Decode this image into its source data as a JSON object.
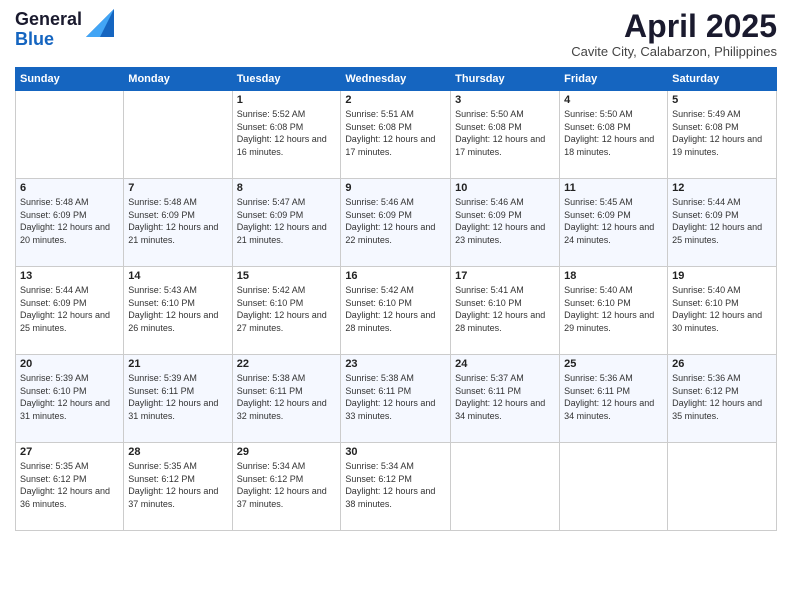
{
  "header": {
    "logo_general": "General",
    "logo_blue": "Blue",
    "month_title": "April 2025",
    "location": "Cavite City, Calabarzon, Philippines"
  },
  "days_of_week": [
    "Sunday",
    "Monday",
    "Tuesday",
    "Wednesday",
    "Thursday",
    "Friday",
    "Saturday"
  ],
  "weeks": [
    [
      {
        "num": "",
        "info": ""
      },
      {
        "num": "",
        "info": ""
      },
      {
        "num": "1",
        "info": "Sunrise: 5:52 AM\nSunset: 6:08 PM\nDaylight: 12 hours and 16 minutes."
      },
      {
        "num": "2",
        "info": "Sunrise: 5:51 AM\nSunset: 6:08 PM\nDaylight: 12 hours and 17 minutes."
      },
      {
        "num": "3",
        "info": "Sunrise: 5:50 AM\nSunset: 6:08 PM\nDaylight: 12 hours and 17 minutes."
      },
      {
        "num": "4",
        "info": "Sunrise: 5:50 AM\nSunset: 6:08 PM\nDaylight: 12 hours and 18 minutes."
      },
      {
        "num": "5",
        "info": "Sunrise: 5:49 AM\nSunset: 6:08 PM\nDaylight: 12 hours and 19 minutes."
      }
    ],
    [
      {
        "num": "6",
        "info": "Sunrise: 5:48 AM\nSunset: 6:09 PM\nDaylight: 12 hours and 20 minutes."
      },
      {
        "num": "7",
        "info": "Sunrise: 5:48 AM\nSunset: 6:09 PM\nDaylight: 12 hours and 21 minutes."
      },
      {
        "num": "8",
        "info": "Sunrise: 5:47 AM\nSunset: 6:09 PM\nDaylight: 12 hours and 21 minutes."
      },
      {
        "num": "9",
        "info": "Sunrise: 5:46 AM\nSunset: 6:09 PM\nDaylight: 12 hours and 22 minutes."
      },
      {
        "num": "10",
        "info": "Sunrise: 5:46 AM\nSunset: 6:09 PM\nDaylight: 12 hours and 23 minutes."
      },
      {
        "num": "11",
        "info": "Sunrise: 5:45 AM\nSunset: 6:09 PM\nDaylight: 12 hours and 24 minutes."
      },
      {
        "num": "12",
        "info": "Sunrise: 5:44 AM\nSunset: 6:09 PM\nDaylight: 12 hours and 25 minutes."
      }
    ],
    [
      {
        "num": "13",
        "info": "Sunrise: 5:44 AM\nSunset: 6:09 PM\nDaylight: 12 hours and 25 minutes."
      },
      {
        "num": "14",
        "info": "Sunrise: 5:43 AM\nSunset: 6:10 PM\nDaylight: 12 hours and 26 minutes."
      },
      {
        "num": "15",
        "info": "Sunrise: 5:42 AM\nSunset: 6:10 PM\nDaylight: 12 hours and 27 minutes."
      },
      {
        "num": "16",
        "info": "Sunrise: 5:42 AM\nSunset: 6:10 PM\nDaylight: 12 hours and 28 minutes."
      },
      {
        "num": "17",
        "info": "Sunrise: 5:41 AM\nSunset: 6:10 PM\nDaylight: 12 hours and 28 minutes."
      },
      {
        "num": "18",
        "info": "Sunrise: 5:40 AM\nSunset: 6:10 PM\nDaylight: 12 hours and 29 minutes."
      },
      {
        "num": "19",
        "info": "Sunrise: 5:40 AM\nSunset: 6:10 PM\nDaylight: 12 hours and 30 minutes."
      }
    ],
    [
      {
        "num": "20",
        "info": "Sunrise: 5:39 AM\nSunset: 6:10 PM\nDaylight: 12 hours and 31 minutes."
      },
      {
        "num": "21",
        "info": "Sunrise: 5:39 AM\nSunset: 6:11 PM\nDaylight: 12 hours and 31 minutes."
      },
      {
        "num": "22",
        "info": "Sunrise: 5:38 AM\nSunset: 6:11 PM\nDaylight: 12 hours and 32 minutes."
      },
      {
        "num": "23",
        "info": "Sunrise: 5:38 AM\nSunset: 6:11 PM\nDaylight: 12 hours and 33 minutes."
      },
      {
        "num": "24",
        "info": "Sunrise: 5:37 AM\nSunset: 6:11 PM\nDaylight: 12 hours and 34 minutes."
      },
      {
        "num": "25",
        "info": "Sunrise: 5:36 AM\nSunset: 6:11 PM\nDaylight: 12 hours and 34 minutes."
      },
      {
        "num": "26",
        "info": "Sunrise: 5:36 AM\nSunset: 6:12 PM\nDaylight: 12 hours and 35 minutes."
      }
    ],
    [
      {
        "num": "27",
        "info": "Sunrise: 5:35 AM\nSunset: 6:12 PM\nDaylight: 12 hours and 36 minutes."
      },
      {
        "num": "28",
        "info": "Sunrise: 5:35 AM\nSunset: 6:12 PM\nDaylight: 12 hours and 37 minutes."
      },
      {
        "num": "29",
        "info": "Sunrise: 5:34 AM\nSunset: 6:12 PM\nDaylight: 12 hours and 37 minutes."
      },
      {
        "num": "30",
        "info": "Sunrise: 5:34 AM\nSunset: 6:12 PM\nDaylight: 12 hours and 38 minutes."
      },
      {
        "num": "",
        "info": ""
      },
      {
        "num": "",
        "info": ""
      },
      {
        "num": "",
        "info": ""
      }
    ]
  ]
}
